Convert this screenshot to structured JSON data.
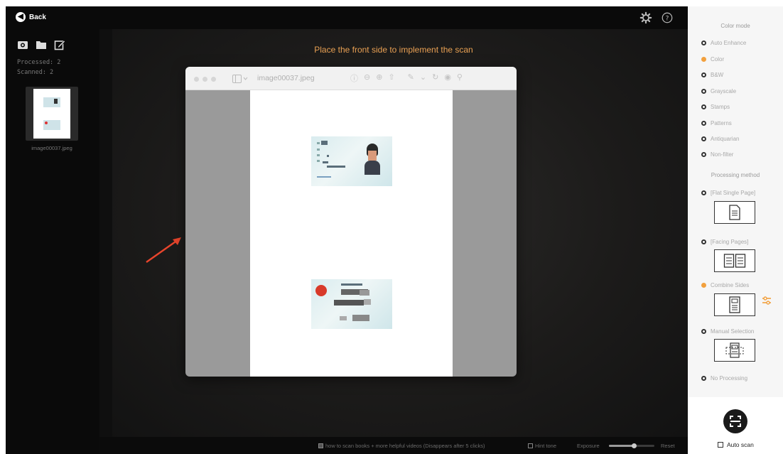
{
  "topbar": {
    "back_label": "Back",
    "icons": [
      "gear-icon",
      "help-icon"
    ]
  },
  "sidebar": {
    "tools": [
      "camera-icon",
      "folder-icon",
      "edit-icon"
    ],
    "processed": "Processed:  2",
    "scanned": "Scanned:  2",
    "thumbnail_name": "image00037.jpeg"
  },
  "main": {
    "instruction": "Place the front side to implement the scan"
  },
  "preview": {
    "title": "image00037.jpeg",
    "toolbar_icons": [
      "info-icon",
      "zoom-out-icon",
      "zoom-in-icon",
      "share-icon",
      "markup-icon",
      "rotate-icon",
      "annotate-icon",
      "search-icon"
    ]
  },
  "bottombar": {
    "help_text": "how to scan books + more helpful videos (Disappears after 5 clicks)",
    "hint_text": "Hint tone",
    "exposure_label": "Exposure",
    "exposure_level": 0.55,
    "reset_label": "Reset"
  },
  "right_panel": {
    "color_mode_title": "Color mode",
    "color_modes": [
      {
        "label": "Auto Enhance",
        "selected": false
      },
      {
        "label": "Color",
        "selected": true
      },
      {
        "label": "B&W",
        "selected": false
      },
      {
        "label": "Grayscale",
        "selected": false
      },
      {
        "label": "Stamps",
        "selected": false
      },
      {
        "label": "Patterns",
        "selected": false
      },
      {
        "label": "Antiquarian",
        "selected": false
      },
      {
        "label": "Non-filter",
        "selected": false
      }
    ],
    "processing_title": "Processing method",
    "methods": [
      {
        "label": "[Flat Single Page]",
        "selected": false,
        "icon": "single-page-icon"
      },
      {
        "label": "[Facing Pages]",
        "selected": false,
        "icon": "facing-pages-icon"
      },
      {
        "label": "Combine Sides",
        "selected": true,
        "icon": "combine-sides-icon"
      },
      {
        "label": "Manual Selection",
        "selected": false,
        "icon": "manual-selection-icon"
      },
      {
        "label": "No Processing",
        "selected": false
      }
    ],
    "auto_scan_label": "Auto scan"
  },
  "colors": {
    "accent": "#f2a03d",
    "instruction": "#e8a053"
  }
}
